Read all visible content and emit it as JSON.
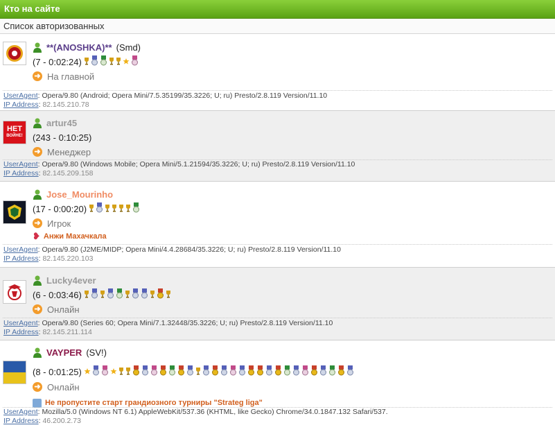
{
  "header": {
    "title": "Кто на сайте"
  },
  "subheader": {
    "title": "Список авторизованных"
  },
  "labels": {
    "useragent": "UserAgent",
    "ip": "IP Address"
  },
  "users": [
    {
      "name": "**(ANOSHKA)**",
      "name_color": "#5a3d8a",
      "extra": "(Smd)",
      "stats": "(7 - 0:02:24)",
      "location": "На главной",
      "useragent": ": Opera/9.80 (Android; Opera Mini/7.5.35199/35.3226; U; ru) Presto/2.8.119 Version/11.10",
      "ip": "82.145.210.78",
      "avatar": "galatasaray-logo",
      "medals": [
        "cup",
        "medal-blue",
        "medal-green",
        "cup",
        "cup",
        "star",
        "medal-pink"
      ]
    },
    {
      "name": "artur45",
      "name_color": "#9b9b9b",
      "extra": "",
      "stats": "(243 - 0:10:25)",
      "location": "Менеджер",
      "useragent": ": Opera/9.80 (Windows Mobile; Opera Mini/5.1.21594/35.3226; U; ru) Presto/2.8.119 Version/11.10",
      "ip": "82.145.209.158",
      "avatar": "net-voine-logo",
      "avatar_text": [
        "НЕТ",
        "ВОЙНЕ!"
      ],
      "medals": []
    },
    {
      "name": "Jose_Mourinho",
      "name_color": "#f08c64",
      "extra": "",
      "stats": "(17 - 0:00:20)",
      "location": "Игрок",
      "club": "Анжи Махачкала",
      "useragent": ": Opera/9.80 (J2ME/MIDP; Opera Mini/4.4.28684/35.3226; U; ru) Presto/2.8.119 Version/11.10",
      "ip": "82.145.220.103",
      "avatar": "anzhi-logo",
      "medals": [
        "cup",
        "medal-blue",
        "cup",
        "cup",
        "cup",
        "cup",
        "medal-green"
      ]
    },
    {
      "name": "Lucky4ever",
      "name_color": "#9b9b9b",
      "extra": "",
      "stats": "(6 - 0:03:46)",
      "location": "Онлайн",
      "useragent": ": Opera/9.80 (Series 60; Opera Mini/7.1.32448/35.3226; U; ru) Presto/2.8.119 Version/11.10",
      "ip": "82.145.211.114",
      "avatar": "benfica-logo",
      "medals": [
        "cup",
        "medal-blue",
        "cup",
        "medal-blue",
        "medal-green",
        "cup",
        "medal-blue",
        "medal-blue",
        "cup",
        "medal-gold",
        "cup"
      ]
    },
    {
      "name": "VAYPER",
      "name_color": "#8b1a4a",
      "extra": "(SV!)",
      "stats": "(8 - 0:01:25)",
      "location": "Онлайн",
      "club": "Не пропустите старт грандиозного турниры \"Strateg liga\"",
      "useragent": ": Mozilla/5.0 (Windows NT 6.1) AppleWebKit/537.36 (KHTML, like Gecko) Chrome/34.0.1847.132 Safari/537.",
      "ip": "46.200.2.73",
      "avatar": "ukraine-flag",
      "medals": [
        "star",
        "medal-blue",
        "medal-pink",
        "star",
        "cup",
        "cup",
        "medal-gold",
        "medal-blue",
        "medal-pink",
        "medal-gold",
        "medal-green",
        "medal-gold",
        "medal-blue",
        "cup",
        "medal-blue",
        "medal-gold",
        "medal-blue",
        "medal-pink",
        "medal-blue",
        "medal-gold",
        "medal-gold",
        "medal-blue",
        "medal-gold",
        "medal-green",
        "medal-blue",
        "medal-pink",
        "medal-gold",
        "medal-blue",
        "medal-green",
        "medal-gold",
        "medal-blue"
      ]
    }
  ],
  "colors": {
    "header_green": "#6ab52a",
    "link_blue": "#4a6fa5",
    "status_orange": "#f39c2c"
  }
}
